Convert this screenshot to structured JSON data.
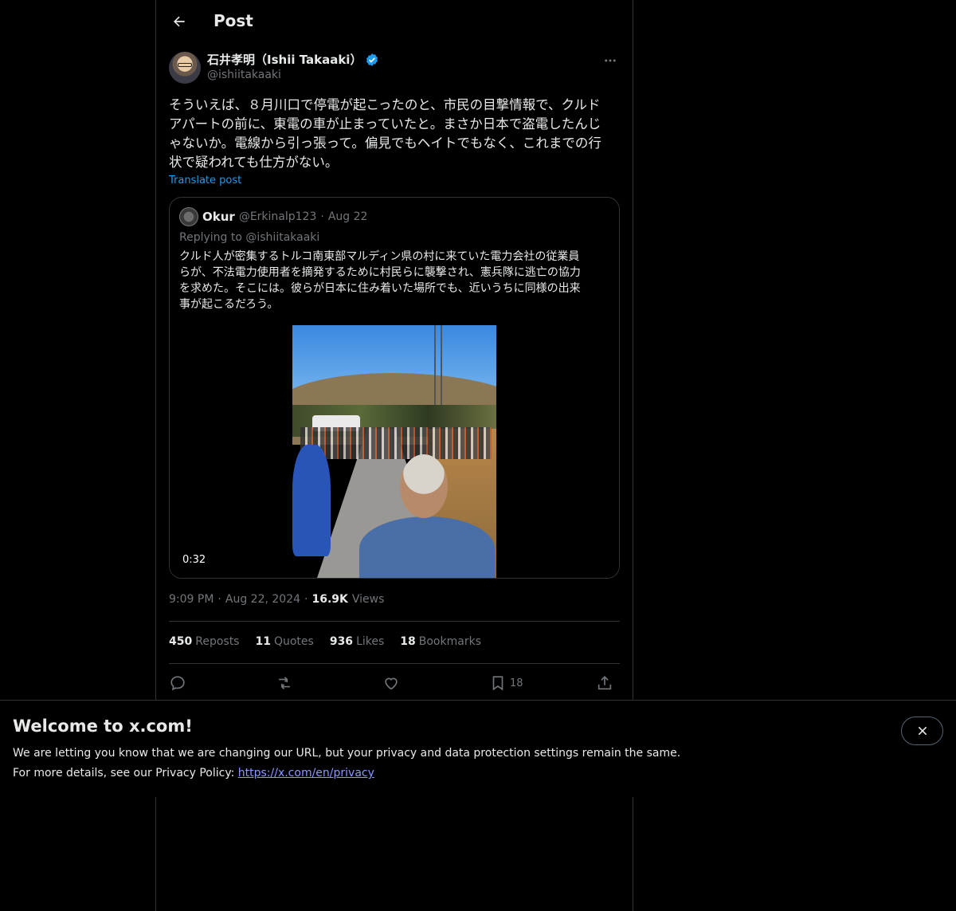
{
  "header": {
    "title": "Post"
  },
  "author": {
    "name": "石井孝明（Ishii Takaaki）",
    "handle": "@ishiitakaaki"
  },
  "post": {
    "text": "そういえば、８月川口で停電が起こったのと、市民の目撃情報で、クルド\nアパートの前に、東電の車が止まっていたと。まさか日本で盗電したんじ\nゃないか。電線から引っ張って。偏見でもヘイトでもなく、これまでの行\n状で疑われても仕方がない。",
    "translate_label": "Translate post"
  },
  "quote": {
    "name": "Okur",
    "handle": "@Erkinalp123",
    "separator": "·",
    "date": "Aug 22",
    "replying": "Replying to @ishiitakaaki",
    "text": "クルド人が密集するトルコ南東部マルディン県の村に来ていた電力会社の従業員\nらが、不法電力使用者を摘発するために村民らに襲撃され、憲兵隊に逃亡の協力\nを求めた。そこには。彼らが日本に住み着いた場所でも、近いうちに同様の出来\n事が起こるだろう。",
    "video_duration": "0:32"
  },
  "meta": {
    "time": "9:09 PM",
    "sep": "·",
    "date": "Aug 22, 2024",
    "views_count": "16.9K",
    "views_label": "Views"
  },
  "stats": [
    {
      "count": "450",
      "label": "Reposts"
    },
    {
      "count": "11",
      "label": "Quotes"
    },
    {
      "count": "936",
      "label": "Likes"
    },
    {
      "count": "18",
      "label": "Bookmarks"
    }
  ],
  "actions": {
    "reply_icon": "reply-icon",
    "repost_icon": "repost-icon",
    "like_icon": "heart-icon",
    "bookmark_icon": "bookmark-icon",
    "bookmark_count": "18",
    "share_icon": "share-icon"
  },
  "banner": {
    "title": "Welcome to x.com!",
    "line1": "We are letting you know that we are changing our URL, but your privacy and data protection settings remain the same.",
    "line2_prefix": "For more details, see our Privacy Policy: ",
    "line2_link": "https://x.com/en/privacy"
  },
  "colors": {
    "background": "#000000",
    "text": "#e7e9ea",
    "secondary": "#71767b",
    "accent": "#1d9bf0",
    "border": "#2f3336"
  }
}
